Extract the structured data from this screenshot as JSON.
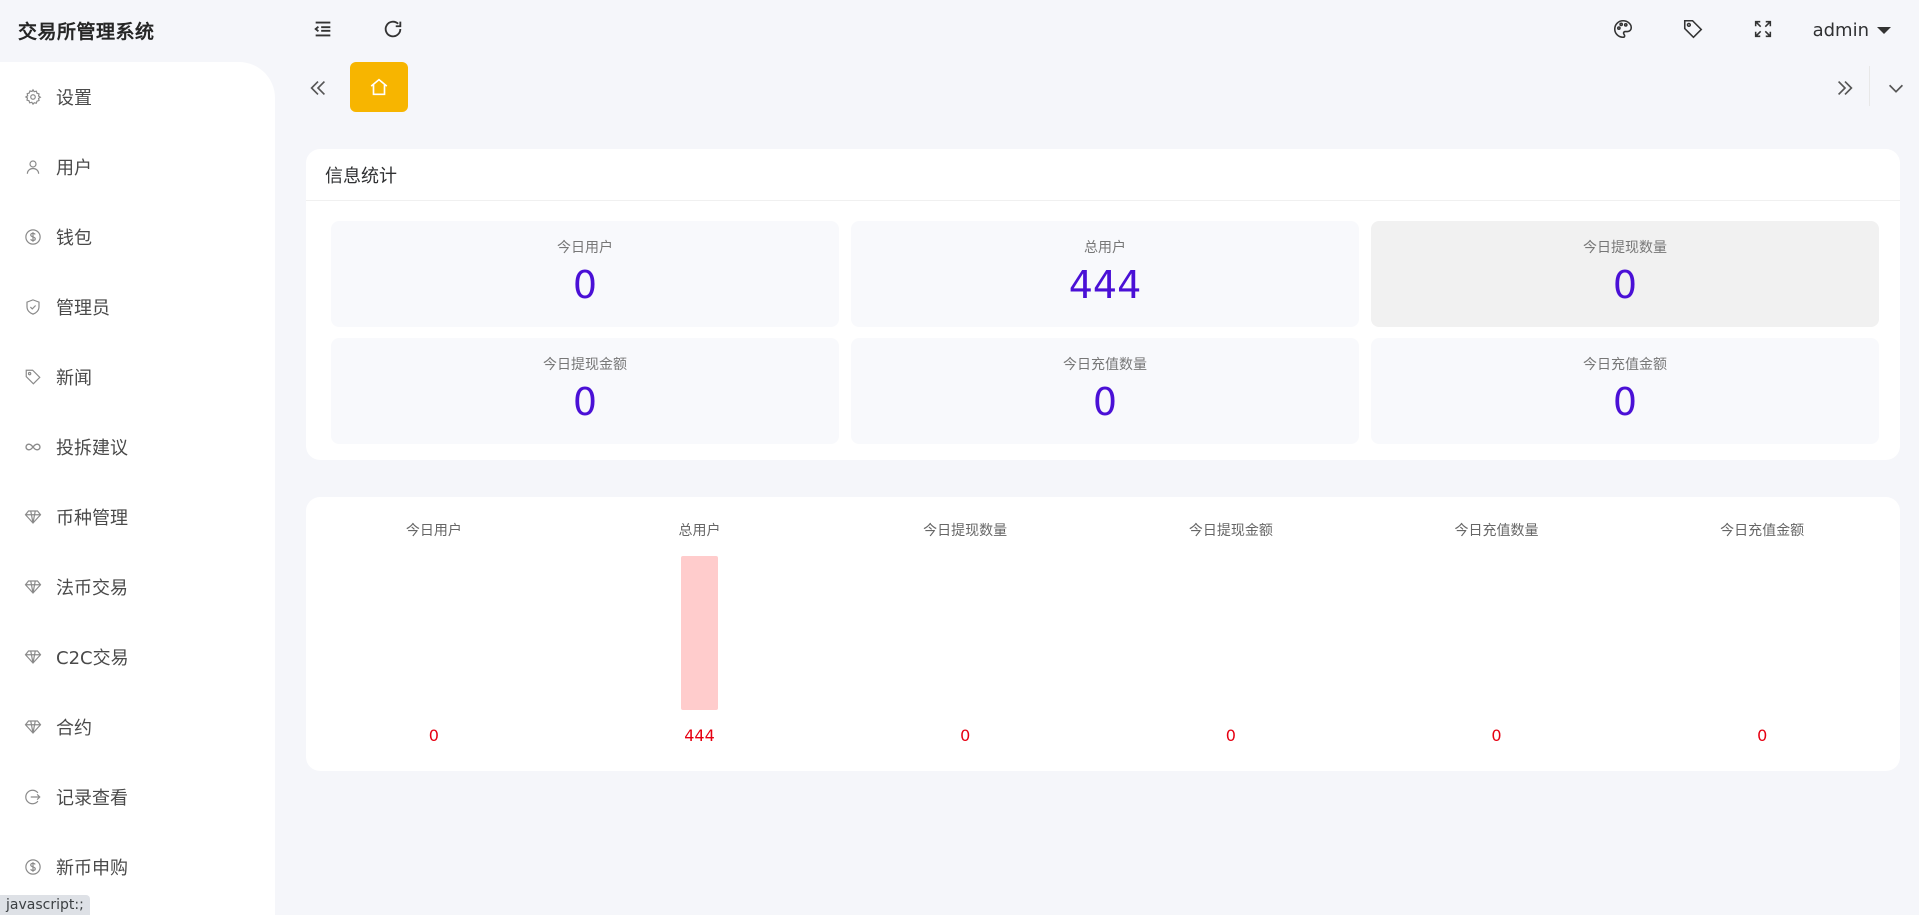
{
  "app": {
    "title": "交易所管理系统"
  },
  "sidebar": {
    "items": [
      {
        "label": "设置",
        "icon": "gear-icon"
      },
      {
        "label": "用户",
        "icon": "user-icon"
      },
      {
        "label": "钱包",
        "icon": "dollar-circle-icon"
      },
      {
        "label": "管理员",
        "icon": "shield-check-icon"
      },
      {
        "label": "新闻",
        "icon": "tag-icon"
      },
      {
        "label": "投拆建议",
        "icon": "infinity-icon"
      },
      {
        "label": "币种管理",
        "icon": "diamond-icon"
      },
      {
        "label": "法币交易",
        "icon": "diamond-icon"
      },
      {
        "label": "C2C交易",
        "icon": "diamond-icon"
      },
      {
        "label": "合约",
        "icon": "diamond-icon"
      },
      {
        "label": "记录查看",
        "icon": "logout-circle-icon"
      },
      {
        "label": "新币申购",
        "icon": "dollar-circle-icon"
      }
    ]
  },
  "header": {
    "user": "admin",
    "icons": [
      "menu-fold-icon",
      "refresh-icon",
      "palette-icon",
      "tag-icon",
      "fullscreen-icon"
    ]
  },
  "tabs": {
    "home_icon": "home-icon",
    "active_color": "#f7b500"
  },
  "stats": {
    "title": "信息统计",
    "items": [
      {
        "label": "今日用户",
        "value": "0"
      },
      {
        "label": "总用户",
        "value": "444"
      },
      {
        "label": "今日提现数量",
        "value": "0"
      },
      {
        "label": "今日提现金额",
        "value": "0"
      },
      {
        "label": "今日充值数量",
        "value": "0"
      },
      {
        "label": "今日充值金额",
        "value": "0"
      }
    ],
    "value_color": "#4a10d6"
  },
  "chart_data": {
    "type": "bar",
    "categories": [
      "今日用户",
      "总用户",
      "今日提现数量",
      "今日提现金额",
      "今日充值数量",
      "今日充值金额"
    ],
    "values": [
      0,
      444,
      0,
      0,
      0,
      0
    ],
    "title": "",
    "xlabel": "",
    "ylabel": "",
    "ylim": [
      0,
      444
    ],
    "grid": false,
    "bar_color": "#ffcccc",
    "value_label_color": "#e60012"
  },
  "status_bar": {
    "text": "javascript:;"
  }
}
